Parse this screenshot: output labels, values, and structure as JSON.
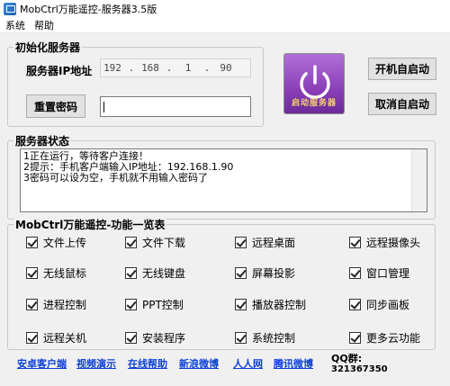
{
  "window": {
    "title": "MobCtrl万能遥控-服务器3.5版"
  },
  "menu": {
    "items": [
      "系统",
      "帮助"
    ]
  },
  "init": {
    "legend": "初始化服务器",
    "ip_label": "服务器IP地址",
    "ip": [
      "192",
      "168",
      "1",
      "90"
    ],
    "reset_password_button": "重置密码",
    "password_value": "",
    "power_caption": "启动服务器",
    "autostart_button": "开机自启动",
    "cancel_autostart_button": "取消自启动"
  },
  "status": {
    "legend": "服务器状态",
    "lines": [
      "1正在运行，等待客户连接！",
      "2提示：手机客户端输入IP地址：192.168.1.90",
      "3密码可以设为空，手机就不用输入密码了"
    ]
  },
  "features": {
    "legend": "MobCtrl万能遥控-功能一览表",
    "items": [
      {
        "label": "文件上传",
        "checked": true
      },
      {
        "label": "文件下载",
        "checked": true
      },
      {
        "label": "远程桌面",
        "checked": true
      },
      {
        "label": "远程摄像头",
        "checked": true
      },
      {
        "label": "无线鼠标",
        "checked": true
      },
      {
        "label": "无线键盘",
        "checked": true
      },
      {
        "label": "屏幕投影",
        "checked": true
      },
      {
        "label": "窗口管理",
        "checked": true
      },
      {
        "label": "进程控制",
        "checked": true
      },
      {
        "label": "PPT控制",
        "checked": true
      },
      {
        "label": "播放器控制",
        "checked": true
      },
      {
        "label": "同步画板",
        "checked": true
      },
      {
        "label": "远程关机",
        "checked": true
      },
      {
        "label": "安装程序",
        "checked": true
      },
      {
        "label": "系统控制",
        "checked": true
      },
      {
        "label": "更多云功能",
        "checked": true
      }
    ]
  },
  "footer": {
    "links": [
      "安卓客户端",
      "视频演示",
      "在线帮助",
      "新浪微博",
      "人人网",
      "腾讯微博"
    ],
    "qq_label": "QQ群:",
    "qq_value": "321367350"
  },
  "colors": {
    "accent_purple": "#8a3fb7",
    "link_blue": "#0b3fd8",
    "caption_gold": "#f7d36a"
  }
}
